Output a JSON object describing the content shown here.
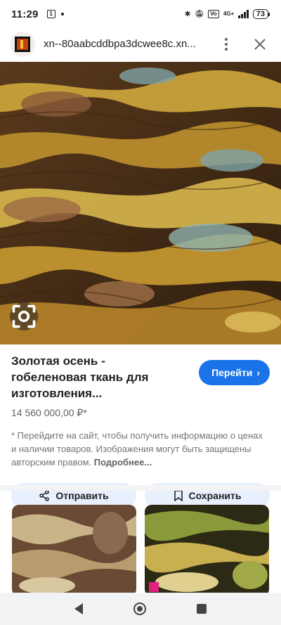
{
  "status": {
    "time": "11:29",
    "badge": "1",
    "hd": "Vo",
    "network": "4G+",
    "battery": "73"
  },
  "header": {
    "url": "xn--80aabcddbpa3dcwee8c.xn..."
  },
  "product": {
    "title": "Золотая осень - гобеленовая ткань для изготовления...",
    "price": "14 560 000,00 ₽*",
    "visit_label": "Перейти",
    "disclaimer": "* Перейдите на сайт, чтобы получить информацию о ценах и наличии товаров. Изображения могут быть защищены авторским правом.",
    "more_label": "Подробнее..."
  },
  "actions": {
    "share_label": "Отправить",
    "save_label": "Сохранить"
  },
  "colors": {
    "accent": "#1a73e8",
    "action_bg": "#e8f0fe"
  }
}
